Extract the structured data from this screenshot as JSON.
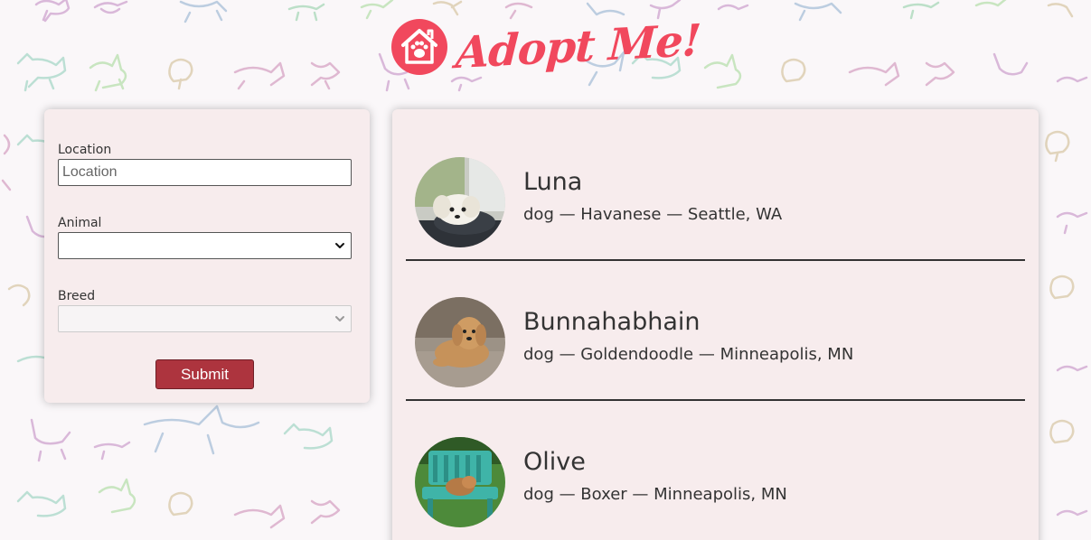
{
  "header": {
    "logo_text": "Adopt Me!",
    "logo_icon": "house-paw-icon"
  },
  "search": {
    "location_label": "Location",
    "location_placeholder": "Location",
    "animal_label": "Animal",
    "animal_value": "",
    "breed_label": "Breed",
    "breed_value": "",
    "submit_label": "Submit"
  },
  "pets": [
    {
      "name": "Luna",
      "info": "dog — Havanese — Seattle, WA"
    },
    {
      "name": "Bunnahabhain",
      "info": "dog — Goldendoodle — Minneapolis, MN"
    },
    {
      "name": "Olive",
      "info": "dog — Boxer — Minneapolis, MN"
    }
  ],
  "colors": {
    "brand": "#f1485d",
    "button": "#ad343e",
    "panel": "#f7eced"
  }
}
